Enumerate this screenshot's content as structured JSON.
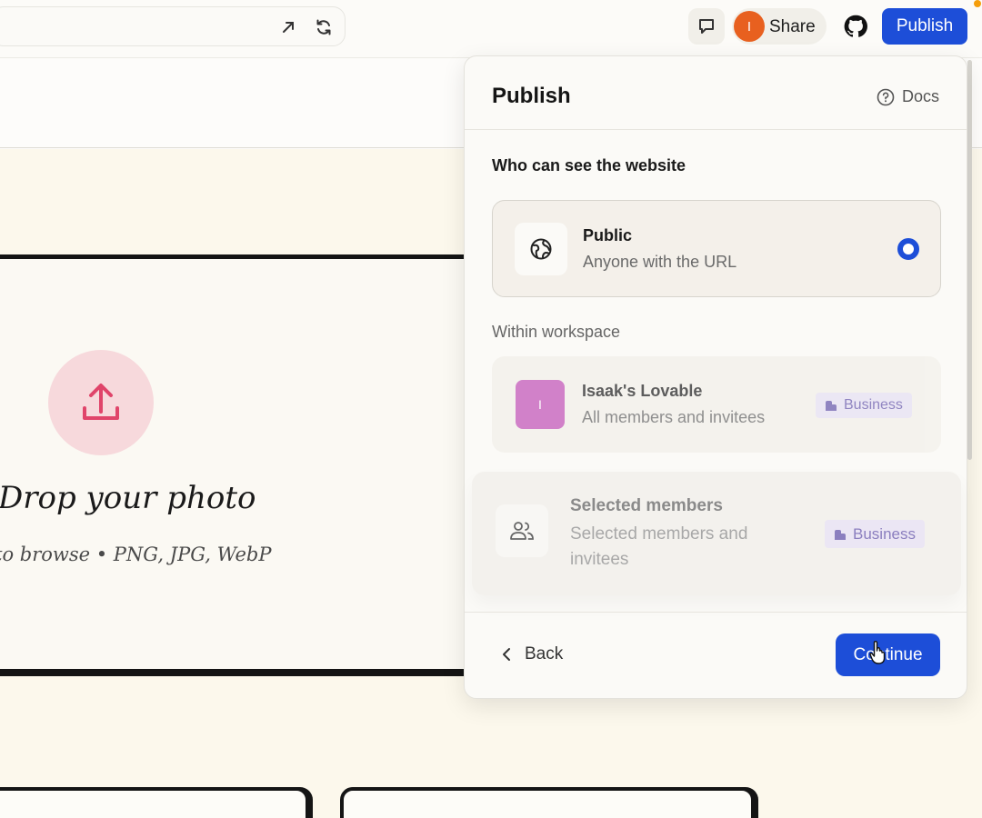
{
  "topbar": {
    "share_label": "Share",
    "avatar_initial": "I",
    "publish_label": "Publish"
  },
  "preview": {
    "drop_title": "Drop your photo",
    "drop_sub": "to browse • PNG, JPG, WebP"
  },
  "panel": {
    "title": "Publish",
    "docs_label": "Docs",
    "section_heading": "Who can see the website",
    "public": {
      "title": "Public",
      "sub": "Anyone with the URL"
    },
    "within_label": "Within workspace",
    "workspace": {
      "avatar_initial": "I",
      "title": "Isaak's Lovable",
      "sub": "All members and invitees",
      "badge": "Business"
    },
    "selected": {
      "title": "Selected members",
      "sub_line1": "Selected members and",
      "sub_line2": "invitees",
      "badge": "Business"
    },
    "back_label": "Back",
    "continue_label": "Continue"
  },
  "colors": {
    "accent": "#1d4ed8",
    "avatar_orange": "#e8601f",
    "workspace_avatar": "#cf7bc7",
    "upload_circle": "#f7d9dc",
    "upload_icon": "#e0446a",
    "badge_text": "#8b7fbf"
  }
}
